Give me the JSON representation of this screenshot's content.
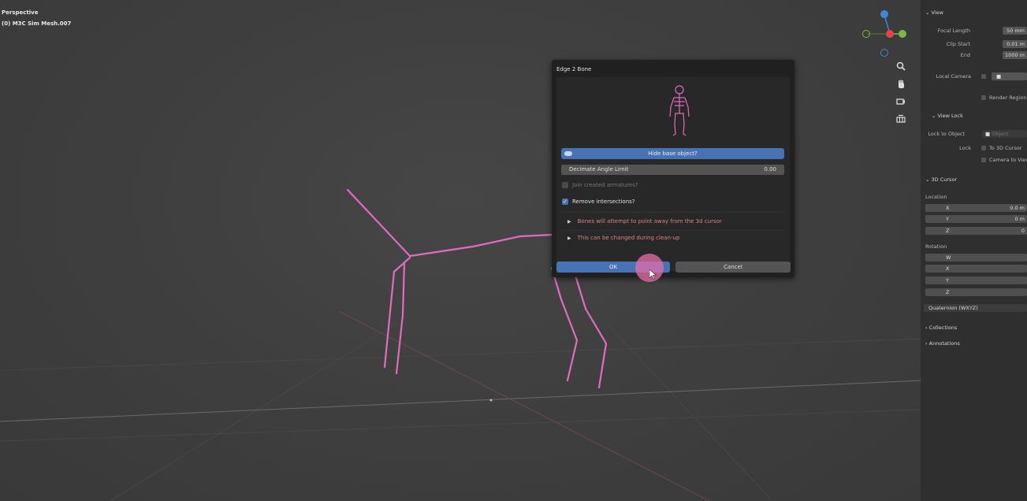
{
  "viewport": {
    "title": "Perspective",
    "object": "(0) M3C Sim Mesh.007",
    "colors": {
      "rig": "#e06cc0",
      "grid_x": "#8a4a4a",
      "grid_y": "#5f7a3a"
    }
  },
  "nav_gizmo": {
    "icons": [
      "zoom-icon",
      "hand-pan-icon",
      "camera-icon",
      "grid-icon"
    ],
    "axes": {
      "x": "#e0454a",
      "y": "#7db54a",
      "z": "#3f86d6"
    }
  },
  "sidebar": {
    "view": {
      "header": "View",
      "focal_length_label": "Focal Length",
      "focal_length_value": "50 mm",
      "clip_start_label": "Clip Start",
      "clip_start_value": "0.01 m",
      "end_label": "End",
      "end_value": "1000 m",
      "local_camera_label": "Local Camera",
      "render_region_label": "Render Region"
    },
    "view_lock": {
      "header": "View Lock",
      "lock_to_object_label": "Lock to Object",
      "lock_to_object_placeholder": "Object",
      "lock_label": "Lock",
      "to_3d_cursor_label": "To 3D Cursor",
      "camera_to_view_label": "Camera to View"
    },
    "cursor": {
      "header": "3D Cursor",
      "location_label": "Location",
      "location": [
        {
          "axis": "X",
          "value": "0.0 m"
        },
        {
          "axis": "Y",
          "value": "0 m"
        },
        {
          "axis": "Z",
          "value": "0"
        }
      ],
      "rotation_label": "Rotation",
      "rotation_axes": [
        "W",
        "X",
        "Y",
        "Z"
      ],
      "rotation_mode": "Quaternion (WXYZ)"
    },
    "collections_label": "Collections",
    "annotations_label": "Annotations"
  },
  "dialog": {
    "title": "Edge 2 Bone",
    "hide_base_label": "Hide base object?",
    "decimate_label": "Decimate Angle Limit",
    "decimate_value": "0.00",
    "join_label": "Join created armatures?",
    "join_checked": false,
    "remove_label": "Remove intersections?",
    "remove_checked": true,
    "info_1": "Bones will attempt to point away from the 3d cursor",
    "info_2": "This can be changed during clean-up",
    "ok_label": "OK",
    "cancel_label": "Cancel"
  }
}
